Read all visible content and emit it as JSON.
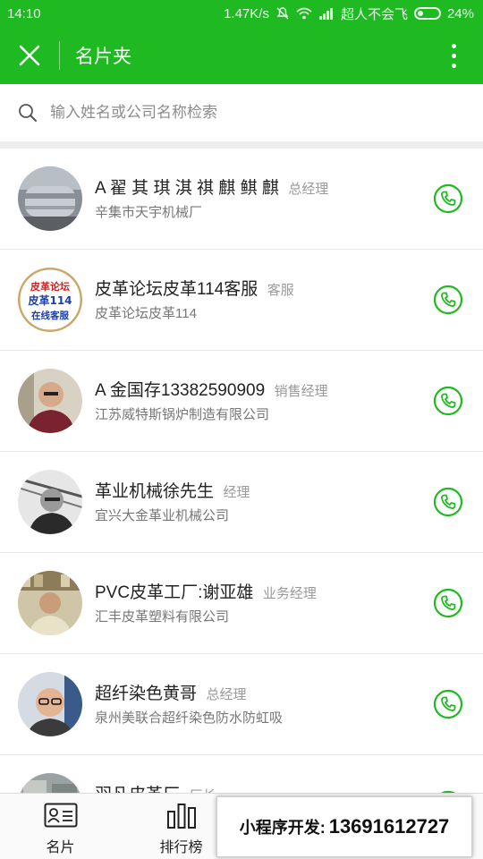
{
  "status_bar": {
    "time": "14:10",
    "speed": "1.47K/s",
    "carrier": "超人不会飞",
    "battery": "24%"
  },
  "nav": {
    "title": "名片夹"
  },
  "search": {
    "placeholder": "输入姓名或公司名称检索"
  },
  "contacts": [
    {
      "name": "A 翟 其 琪 淇 祺 麒 鲯 麒",
      "title": "总经理",
      "company": "辛集市天宇机械厂"
    },
    {
      "name": "皮革论坛皮革114客服",
      "title": "客服",
      "company": "皮革论坛皮革114",
      "avatar_lines": [
        "皮革论坛",
        "皮革114",
        "在线客服"
      ]
    },
    {
      "name": "A 金国存13382590909",
      "title": "销售经理",
      "company": "江苏威特斯锅炉制造有限公司"
    },
    {
      "name": "革业机械徐先生",
      "title": "经理",
      "company": "宜兴大金革业机械公司"
    },
    {
      "name": "PVC皮革工厂:谢亚雄",
      "title": "业务经理",
      "company": "汇丰皮革塑料有限公司"
    },
    {
      "name": "超纤染色黄哥",
      "title": "总经理",
      "company": "泉州美联合超纤染色防水防虹吸"
    },
    {
      "name": "羽凡皮革厂",
      "title": "厂长",
      "company": ""
    }
  ],
  "tabs": [
    {
      "label": "名片"
    },
    {
      "label": "排行榜"
    }
  ],
  "promo": {
    "label": "小程序开发:",
    "phone": "13691612727"
  },
  "colors": {
    "brand": "#1fb922",
    "call_icon": "#1fb922"
  }
}
